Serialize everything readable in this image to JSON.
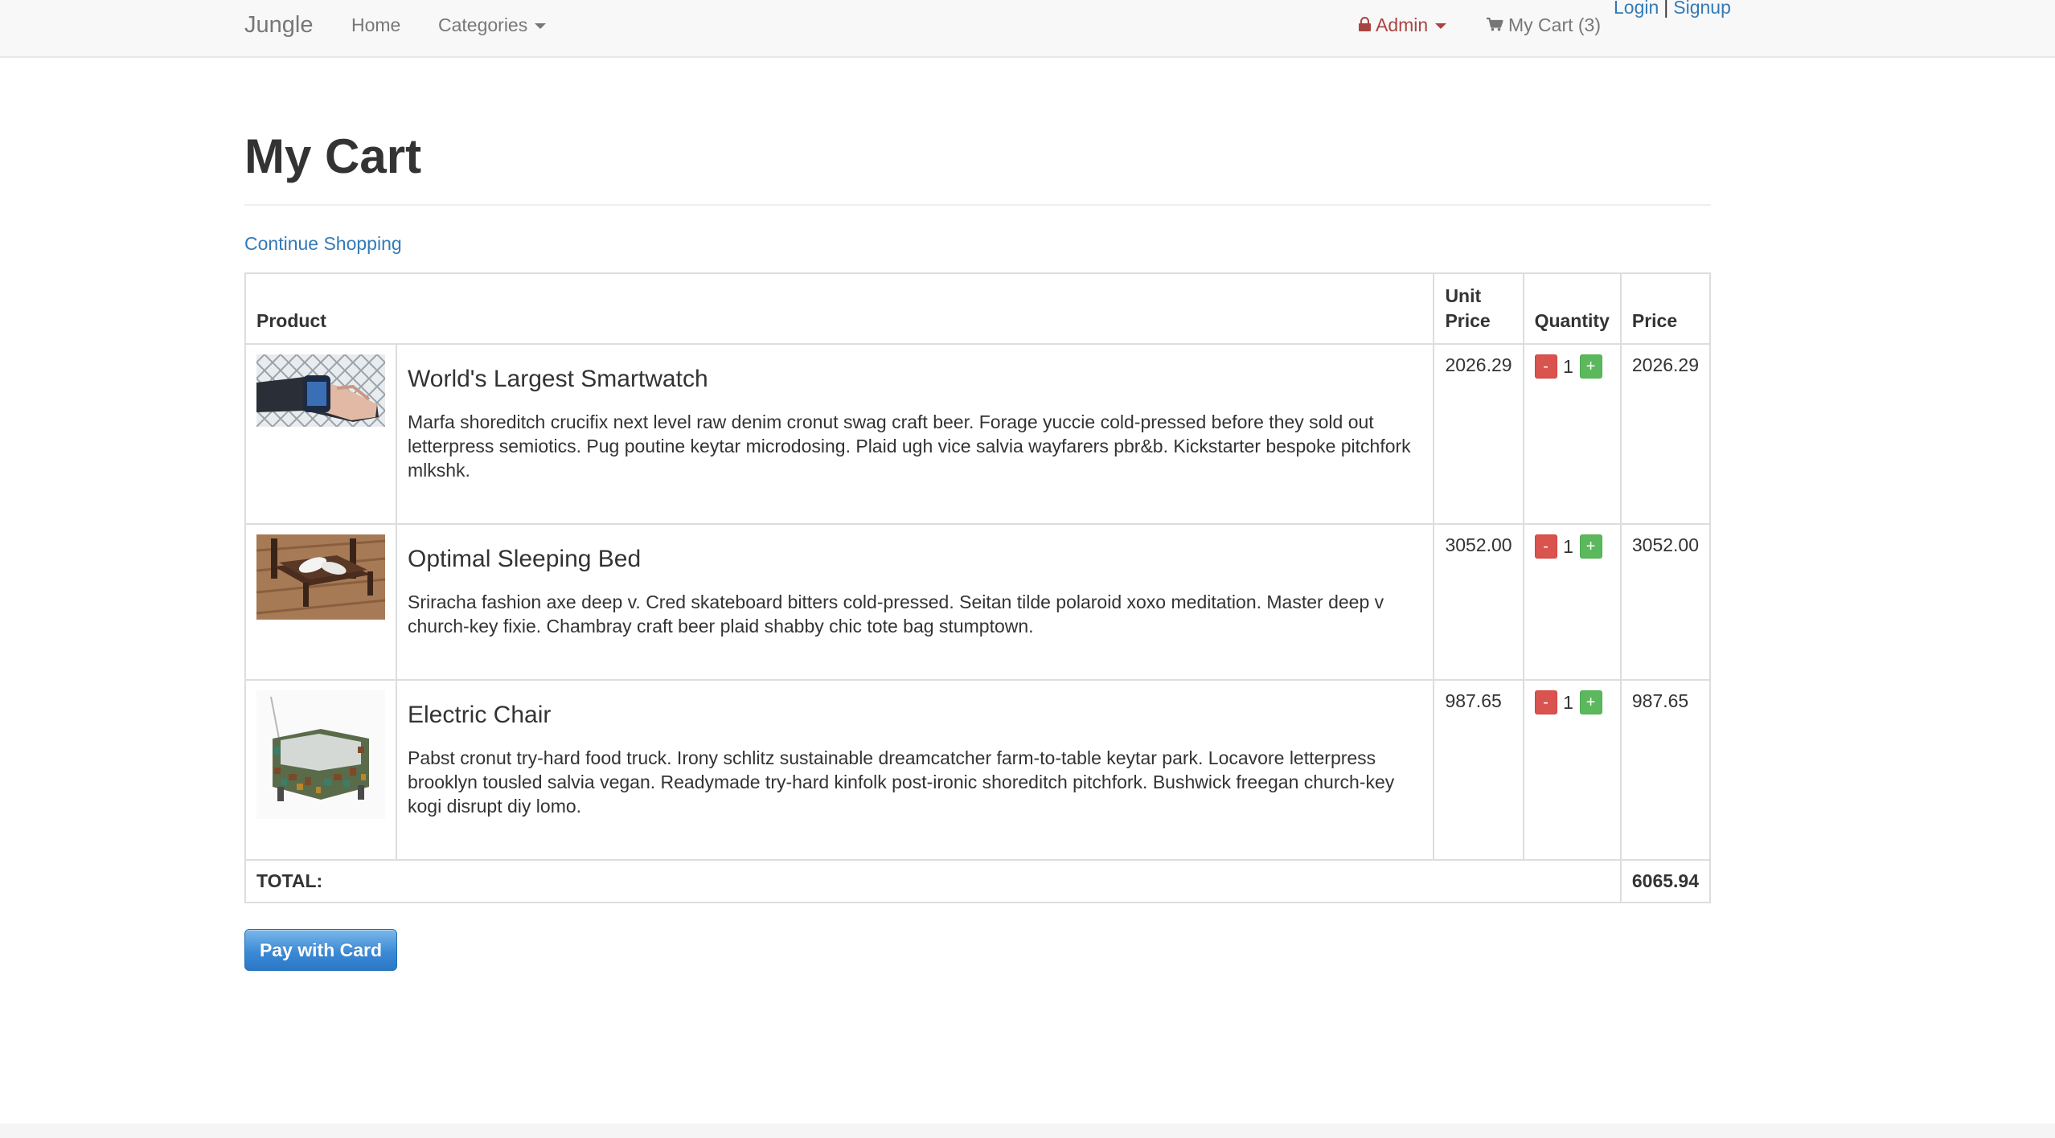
{
  "navbar": {
    "brand": "Jungle",
    "home": "Home",
    "categories": "Categories",
    "admin": "Admin",
    "cart": "My Cart (3)",
    "login": "Login",
    "separator": "|",
    "signup": "Signup",
    "icons": {
      "admin": "lock-icon",
      "cart": "shopping-cart-icon"
    }
  },
  "page": {
    "title": "My Cart",
    "continue_link": "Continue Shopping"
  },
  "table": {
    "headers": {
      "product": "Product",
      "unit_price": "Unit Price",
      "quantity": "Quantity",
      "price": "Price"
    },
    "items": [
      {
        "name": "World's Largest Smartwatch",
        "description": "Marfa shoreditch crucifix next level raw denim cronut swag craft beer. Forage yuccie cold-pressed before they sold out letterpress semiotics. Pug poutine keytar microdosing. Plaid ugh vice salvia wayfarers pbr&b. Kickstarter bespoke pitchfork mlkshk.",
        "unit_price": "2026.29",
        "quantity": "1",
        "price": "2026.29"
      },
      {
        "name": "Optimal Sleeping Bed",
        "description": "Sriracha fashion axe deep v. Cred skateboard bitters cold-pressed. Seitan tilde polaroid xoxo meditation. Master deep v church-key fixie. Chambray craft beer plaid shabby chic tote bag stumptown.",
        "unit_price": "3052.00",
        "quantity": "1",
        "price": "3052.00"
      },
      {
        "name": "Electric Chair",
        "description": "Pabst cronut try-hard food truck. Irony schlitz sustainable dreamcatcher farm-to-table keytar park. Locavore letterpress brooklyn tousled salvia vegan. Readymade try-hard kinfolk post-ironic shoreditch pitchfork. Bushwick freegan church-key kogi disrupt diy lomo.",
        "unit_price": "987.65",
        "quantity": "1",
        "price": "987.65"
      }
    ],
    "minus": "-",
    "plus": "+",
    "total_label": "TOTAL:",
    "total_value": "6065.94"
  },
  "pay_button": "Pay with Card",
  "colors": {
    "link": "#337ab7",
    "admin": "#a94442",
    "minus_button": "#d9534f",
    "plus_button": "#5cb85c",
    "pay_button": "#3c8ad6"
  }
}
